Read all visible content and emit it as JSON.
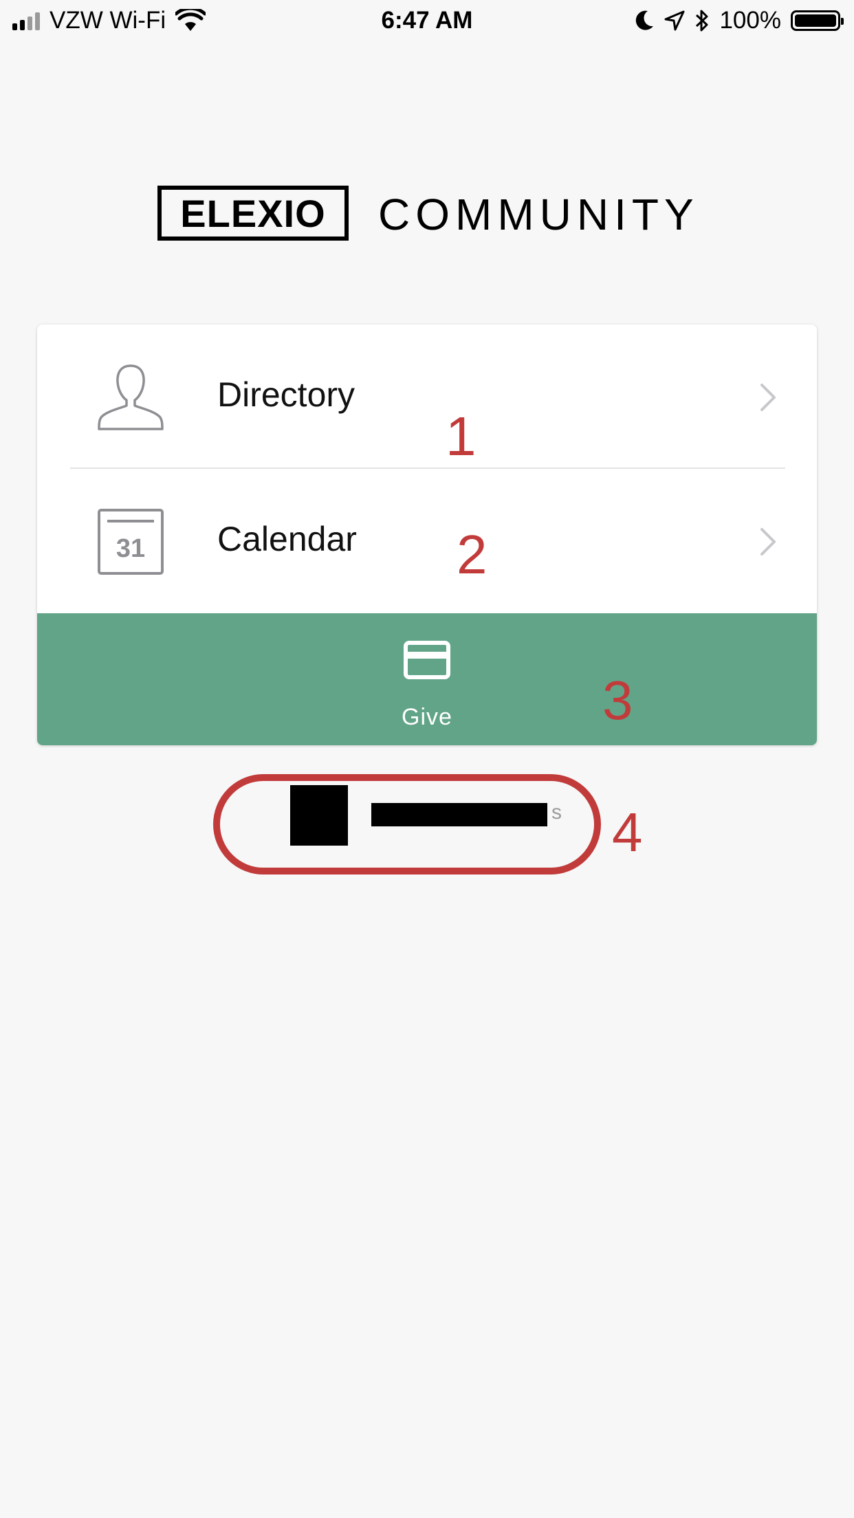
{
  "status_bar": {
    "carrier": "VZW Wi-Fi",
    "time": "6:47 AM",
    "battery": "100%"
  },
  "logo": {
    "brand": "ELEXIO",
    "word": "COMMUNITY"
  },
  "menu": {
    "directory": {
      "label": "Directory",
      "icon": "person-icon"
    },
    "calendar": {
      "label": "Calendar",
      "icon": "calendar-icon",
      "date": "31"
    },
    "give": {
      "label": "Give",
      "icon": "credit-card-icon"
    }
  },
  "footer": {
    "tail_text": "s"
  },
  "annotations": [
    "1",
    "2",
    "3",
    "4"
  ],
  "colors": {
    "background": "#f7f7f7",
    "give_green": "#62a488",
    "annotation_red": "#c23b3b",
    "icon_gray": "#8e8e93",
    "chevron_gray": "#c7c7cc"
  }
}
